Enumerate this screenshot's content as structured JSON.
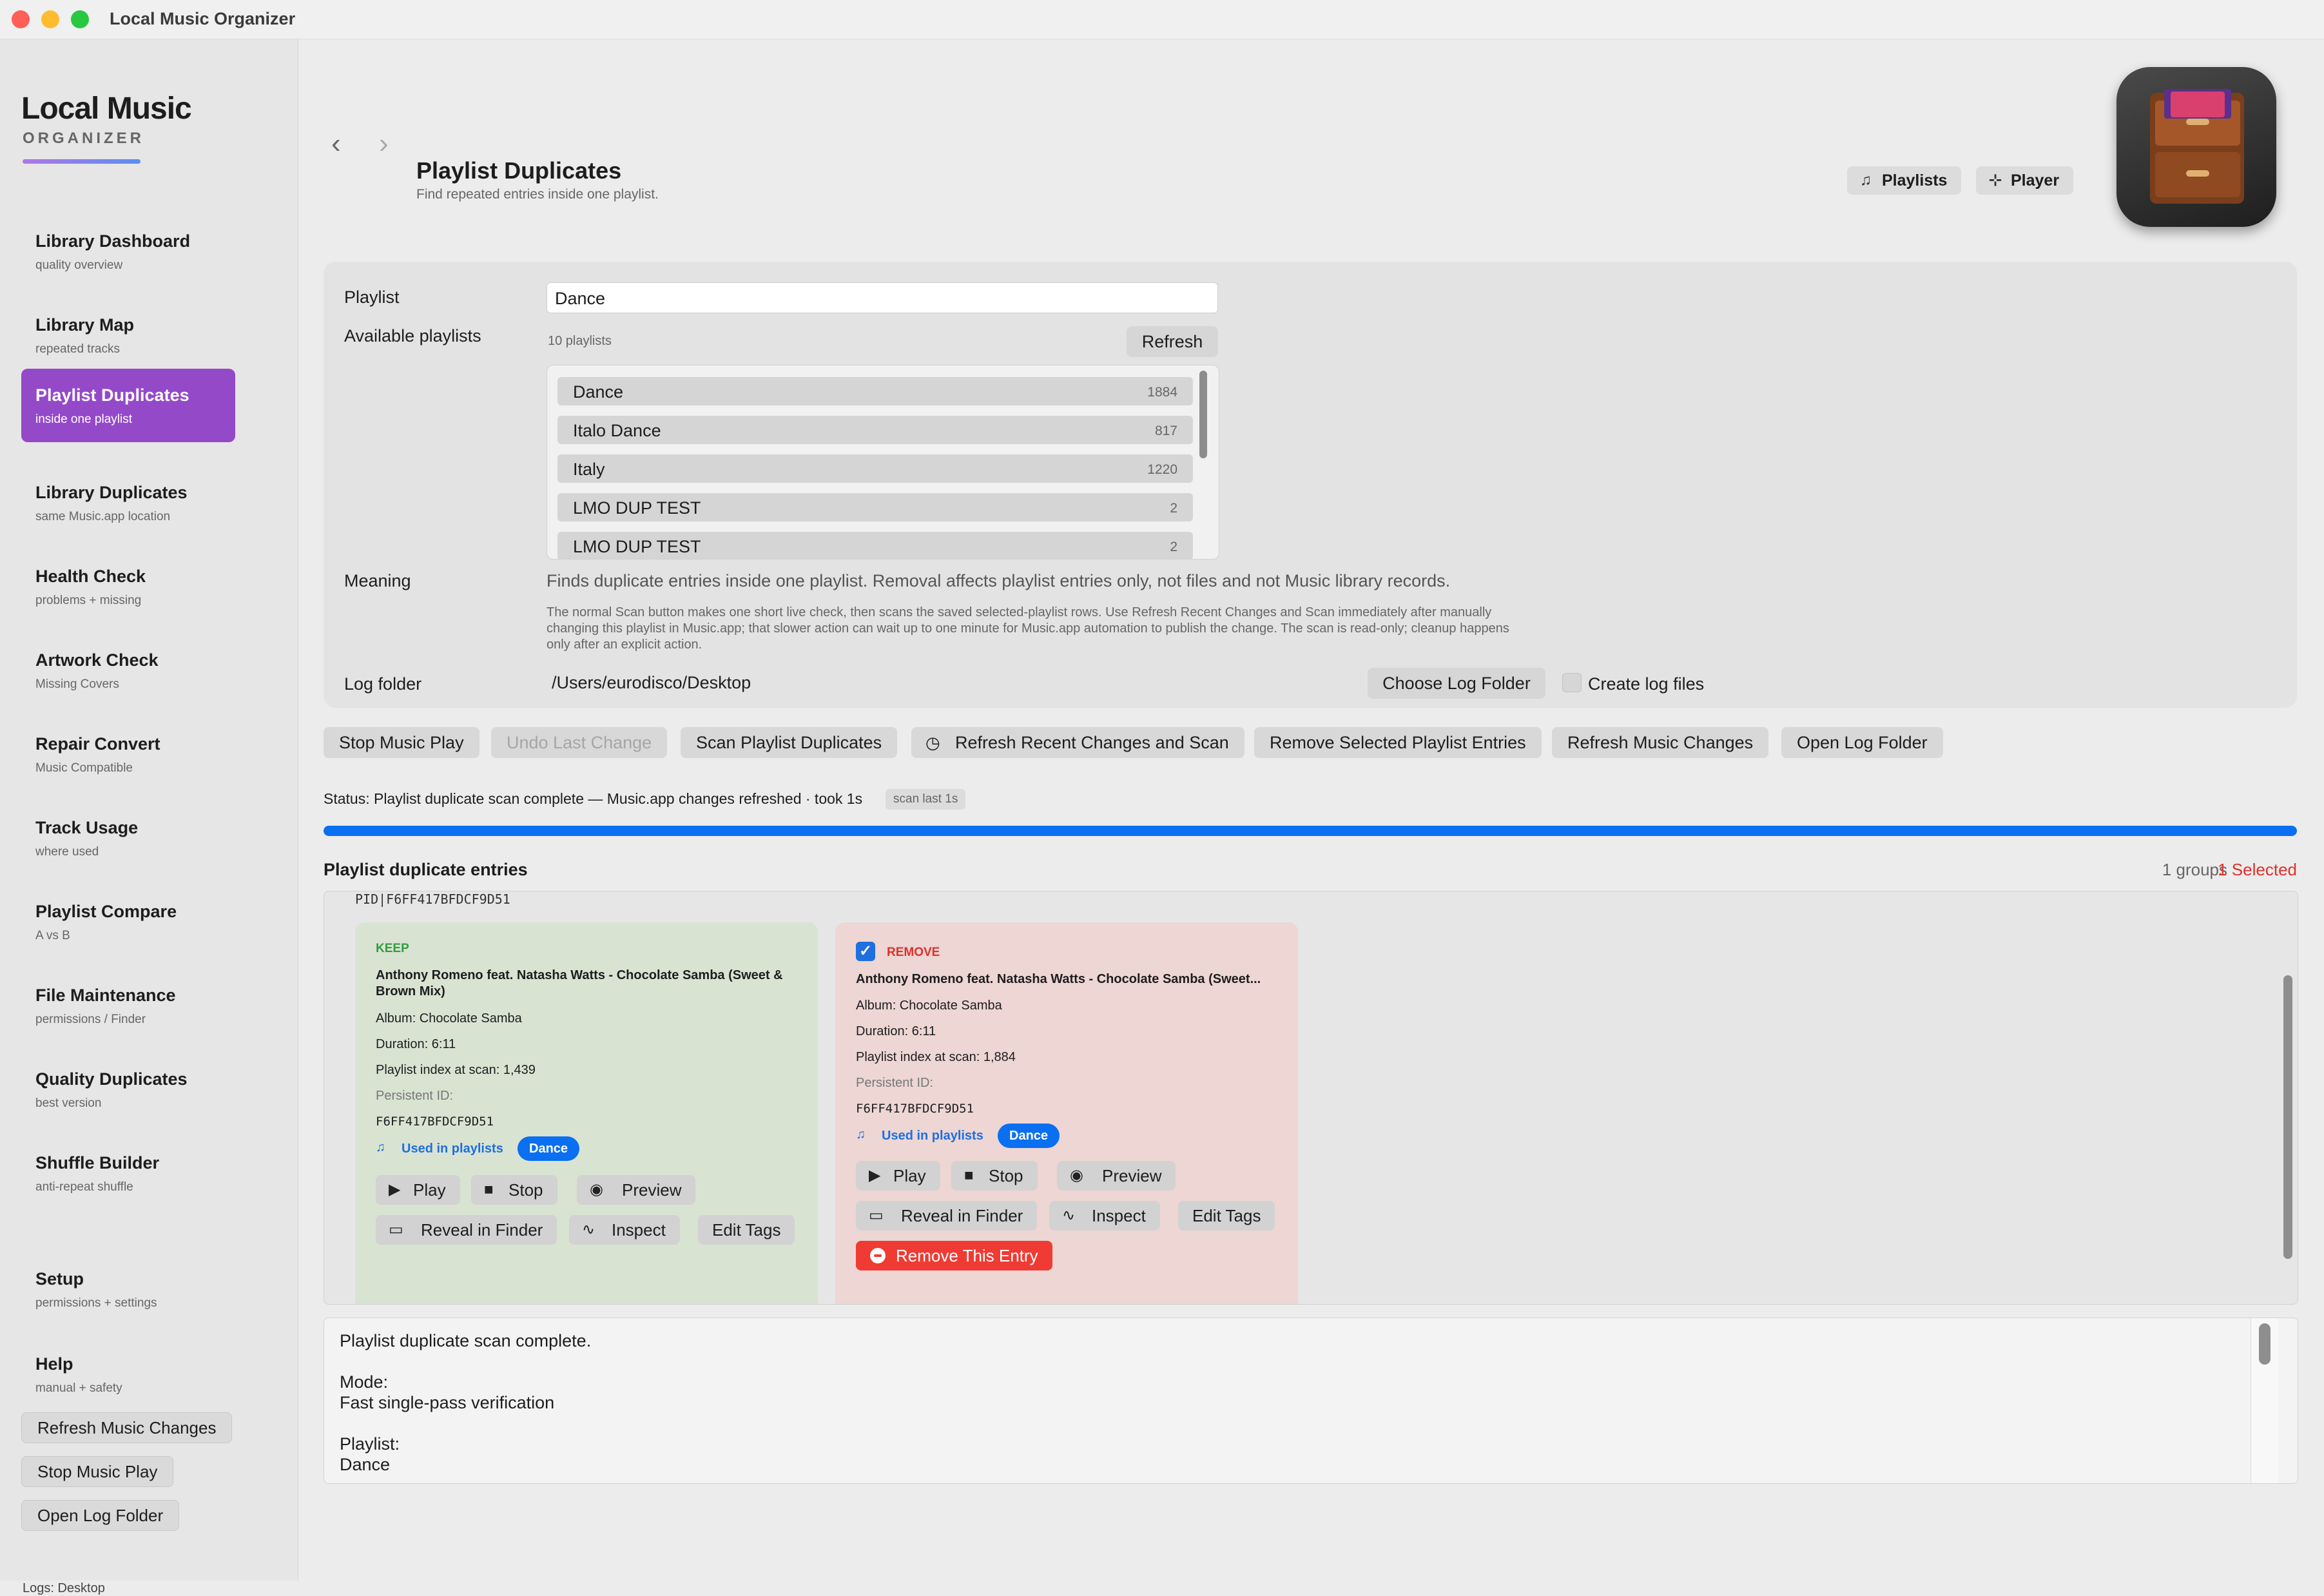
{
  "window": {
    "title": "Local Music Organizer"
  },
  "brand": {
    "title": "Local Music",
    "subtitle": "ORGANIZER"
  },
  "sidebar": {
    "items": [
      {
        "label": "Library Dashboard",
        "sub": "quality overview"
      },
      {
        "label": "Library Map",
        "sub": "repeated tracks"
      },
      {
        "label": "Playlist Duplicates",
        "sub": "inside one playlist"
      },
      {
        "label": "Library Duplicates",
        "sub": "same Music.app location"
      },
      {
        "label": "Health Check",
        "sub": "problems + missing"
      },
      {
        "label": "Artwork Check",
        "sub": "Missing Covers"
      },
      {
        "label": "Repair Convert",
        "sub": "Music Compatible"
      },
      {
        "label": "Track Usage",
        "sub": "where used"
      },
      {
        "label": "Playlist Compare",
        "sub": "A vs B"
      },
      {
        "label": "File Maintenance",
        "sub": "permissions / Finder"
      },
      {
        "label": "Quality Duplicates",
        "sub": "best version"
      },
      {
        "label": "Shuffle Builder",
        "sub": "anti-repeat shuffle"
      },
      {
        "label": "Setup",
        "sub": "permissions + settings"
      },
      {
        "label": "Help",
        "sub": "manual + safety"
      }
    ],
    "active_index": 2,
    "buttons": {
      "refresh": "Refresh Music Changes",
      "stop": "Stop Music Play",
      "open_log": "Open Log Folder"
    },
    "logs_label": "Logs: Desktop"
  },
  "header": {
    "title": "Playlist Duplicates",
    "subtitle": "Find repeated entries inside one playlist.",
    "playlists_btn": "Playlists",
    "player_btn": "Player"
  },
  "form": {
    "playlist_label": "Playlist",
    "playlist_value": "Dance",
    "available_label": "Available playlists",
    "count_text": "10 playlists",
    "refresh_btn": "Refresh",
    "playlists": [
      {
        "name": "Dance",
        "count": "1884"
      },
      {
        "name": "Italo Dance",
        "count": "817"
      },
      {
        "name": "Italy",
        "count": "1220"
      },
      {
        "name": "LMO DUP TEST",
        "count": "2"
      },
      {
        "name": "LMO DUP TEST",
        "count": "2"
      }
    ],
    "meaning_label": "Meaning",
    "meaning_text": "Finds duplicate entries inside one playlist. Removal affects playlist entries only, not files and not Music library records.",
    "meaning_note": "The normal Scan button makes one short live check, then scans the saved selected-playlist rows. Use Refresh Recent Changes and Scan immediately after manually changing this playlist in Music.app; that slower action can wait up to one minute for Music.app automation to publish the change. The scan is read-only; cleanup happens only after an explicit action.",
    "log_label": "Log folder",
    "log_path": "/Users/eurodisco/Desktop",
    "choose_log_btn": "Choose Log Folder",
    "create_log_label": "Create log files"
  },
  "actions": {
    "stop": "Stop Music Play",
    "undo": "Undo Last Change",
    "scan": "Scan Playlist Duplicates",
    "refresh_scan": "Refresh Recent Changes and Scan",
    "remove_selected": "Remove Selected Playlist Entries",
    "refresh_music": "Refresh Music Changes",
    "open_log": "Open Log Folder"
  },
  "status": {
    "text": "Status: Playlist duplicate scan complete — Music.app changes refreshed · took 1s",
    "badge": "scan last 1s",
    "progress": 1.0
  },
  "results": {
    "title": "Playlist duplicate entries",
    "groups": "1 groups",
    "selected": "1 Selected",
    "pid": "PID|F6FF417BFDCF9D51",
    "keep": {
      "tag": "KEEP",
      "name": "Anthony Romeno feat. Natasha Watts - Chocolate Samba (Sweet & Brown Mix)",
      "album": "Album: Chocolate Samba",
      "duration": "Duration: 6:11",
      "index": "Playlist index at scan: 1,439",
      "pid_label": "Persistent ID:",
      "pid": "F6FF417BFDCF9D51",
      "used": "Used in playlists",
      "pill": "Dance"
    },
    "remove": {
      "tag": "REMOVE",
      "name": "Anthony Romeno feat. Natasha Watts - Chocolate Samba (Sweet...",
      "album": "Album: Chocolate Samba",
      "duration": "Duration: 6:11",
      "index": "Playlist index at scan: 1,884",
      "pid_label": "Persistent ID:",
      "pid": "F6FF417BFDCF9D51",
      "used": "Used in playlists",
      "pill": "Dance",
      "remove_btn": "Remove This Entry"
    },
    "buttons": {
      "play": "Play",
      "stop": "Stop",
      "preview": "Preview",
      "reveal": "Reveal in Finder",
      "inspect": "Inspect",
      "edit": "Edit Tags"
    }
  },
  "log": {
    "lines": [
      "Playlist duplicate scan complete.",
      "",
      "Mode:",
      "Fast single-pass verification",
      "",
      "Playlist:",
      "Dance"
    ]
  },
  "colors": {
    "accent_purple": "#9449c9",
    "accent_blue": "#0a6ff0",
    "danger_red": "#ef3b33",
    "keep_green": "#2e9e3e"
  }
}
